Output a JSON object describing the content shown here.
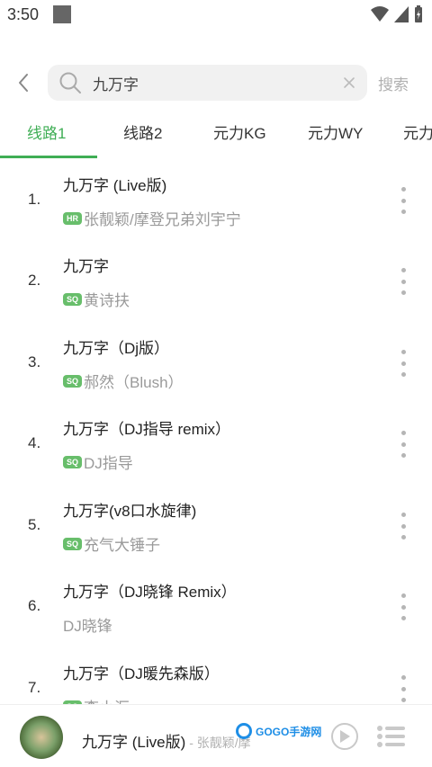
{
  "status": {
    "time": "3:50"
  },
  "search": {
    "query": "九万字",
    "search_label": "搜索"
  },
  "tabs": [
    {
      "label": "线路1"
    },
    {
      "label": "线路2"
    },
    {
      "label": "元力KG"
    },
    {
      "label": "元力WY"
    },
    {
      "label": "元力"
    }
  ],
  "songs": [
    {
      "index": "1.",
      "title": "九万字 (Live版)",
      "badge": "HR",
      "artist": "张靓颖/摩登兄弟刘宇宁"
    },
    {
      "index": "2.",
      "title": "九万字",
      "badge": "SQ",
      "artist": "黄诗扶"
    },
    {
      "index": "3.",
      "title": "九万字（Dj版）",
      "badge": "SQ",
      "artist": "郝然（Blush）"
    },
    {
      "index": "4.",
      "title": "九万字（DJ指导 remix）",
      "badge": "SQ",
      "artist": "DJ指导"
    },
    {
      "index": "5.",
      "title": "九万字(v8口水旋律)",
      "badge": "SQ",
      "artist": "充气大锤子"
    },
    {
      "index": "6.",
      "title": "九万字（DJ晓锋 Remix）",
      "badge": "",
      "artist": "DJ晓锋"
    },
    {
      "index": "7.",
      "title": "九万字（DJ暖先森版）",
      "badge": "SQ",
      "artist": "李小汇"
    }
  ],
  "player": {
    "title": "九万字 (Live版)",
    "artist": "- 张靓颖/摩"
  },
  "watermark": {
    "text": "GOGO手游网"
  },
  "colors": {
    "accent": "#3fae55",
    "badge": "#68be6b"
  }
}
